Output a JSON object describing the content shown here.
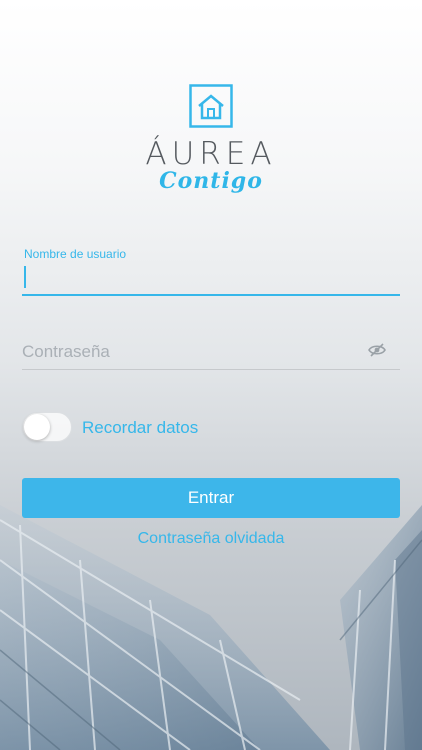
{
  "brand": {
    "name": "ÁUREA",
    "tagline": "Contigo",
    "logo_icon": "house-icon",
    "accent_color": "#36b7ea"
  },
  "form": {
    "username": {
      "label": "Nombre de usuario",
      "value": ""
    },
    "password": {
      "placeholder": "Contraseña",
      "value": "",
      "visibility_icon": "eye-slash-icon"
    },
    "remember": {
      "label": "Recordar datos",
      "enabled": false
    },
    "submit_label": "Entrar",
    "forgot_label": "Contraseña olvidada"
  }
}
